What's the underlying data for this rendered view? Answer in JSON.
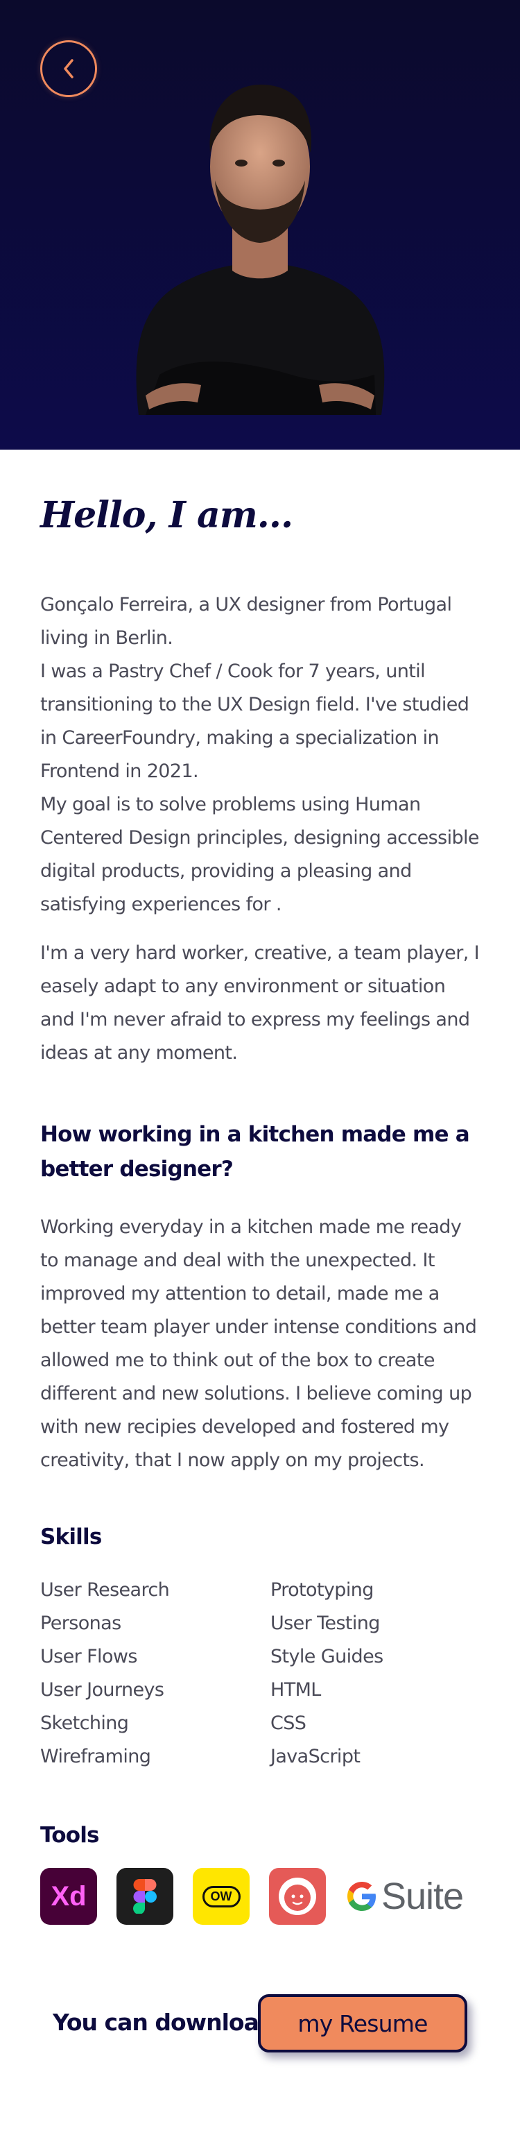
{
  "hero": {
    "back_icon": "chevron-left-icon",
    "background_color": "#0d0b4a",
    "accent_color": "#f08a5d"
  },
  "about": {
    "heading": "Hello, I am...",
    "paragraph1": "Gonçalo Ferreira, a UX designer from Portugal living in Berlin.\nI was a Pastry Chef / Cook for 7 years, until transitioning to the UX Design field. I've studied in CareerFoundry, making a specialization in Frontend in 2021.\nMy goal is to solve problems using Human Centered Design principles, designing accessible digital products, providing a pleasing and satisfying experiences for .",
    "paragraph2": "I'm a very hard worker, creative, a team player, I easely adapt to any environment or situation and I'm never afraid to express my feelings and ideas at any moment."
  },
  "kitchen": {
    "heading": "How working in a kitchen made me a better designer?",
    "text": "Working everyday in a kitchen made me ready to manage and deal with the unexpected. It improved my attention to detail, made me a better team player under intense conditions and allowed me to think out of the box to create different and new solutions. I believe coming up with new recipies developed and fostered my creativity, that I now apply on my projects."
  },
  "skills": {
    "heading": "Skills",
    "left": [
      "User Research",
      "Personas",
      "User Flows",
      "User Journeys",
      "Sketching",
      "Wireframing"
    ],
    "right": [
      "Prototyping",
      "User Testing",
      "Style Guides",
      "HTML",
      "CSS",
      "JavaScript"
    ]
  },
  "tools": {
    "heading": "Tools",
    "items": [
      {
        "icon": "adobe-xd-icon",
        "label": "Xd"
      },
      {
        "icon": "figma-icon"
      },
      {
        "icon": "optimal-workshop-icon",
        "label": "OW"
      },
      {
        "icon": "lookback-icon"
      },
      {
        "icon": "google-g-icon",
        "label": "Suite"
      }
    ]
  },
  "footer": {
    "download_label": "You can download",
    "resume_button": "my Resume"
  }
}
